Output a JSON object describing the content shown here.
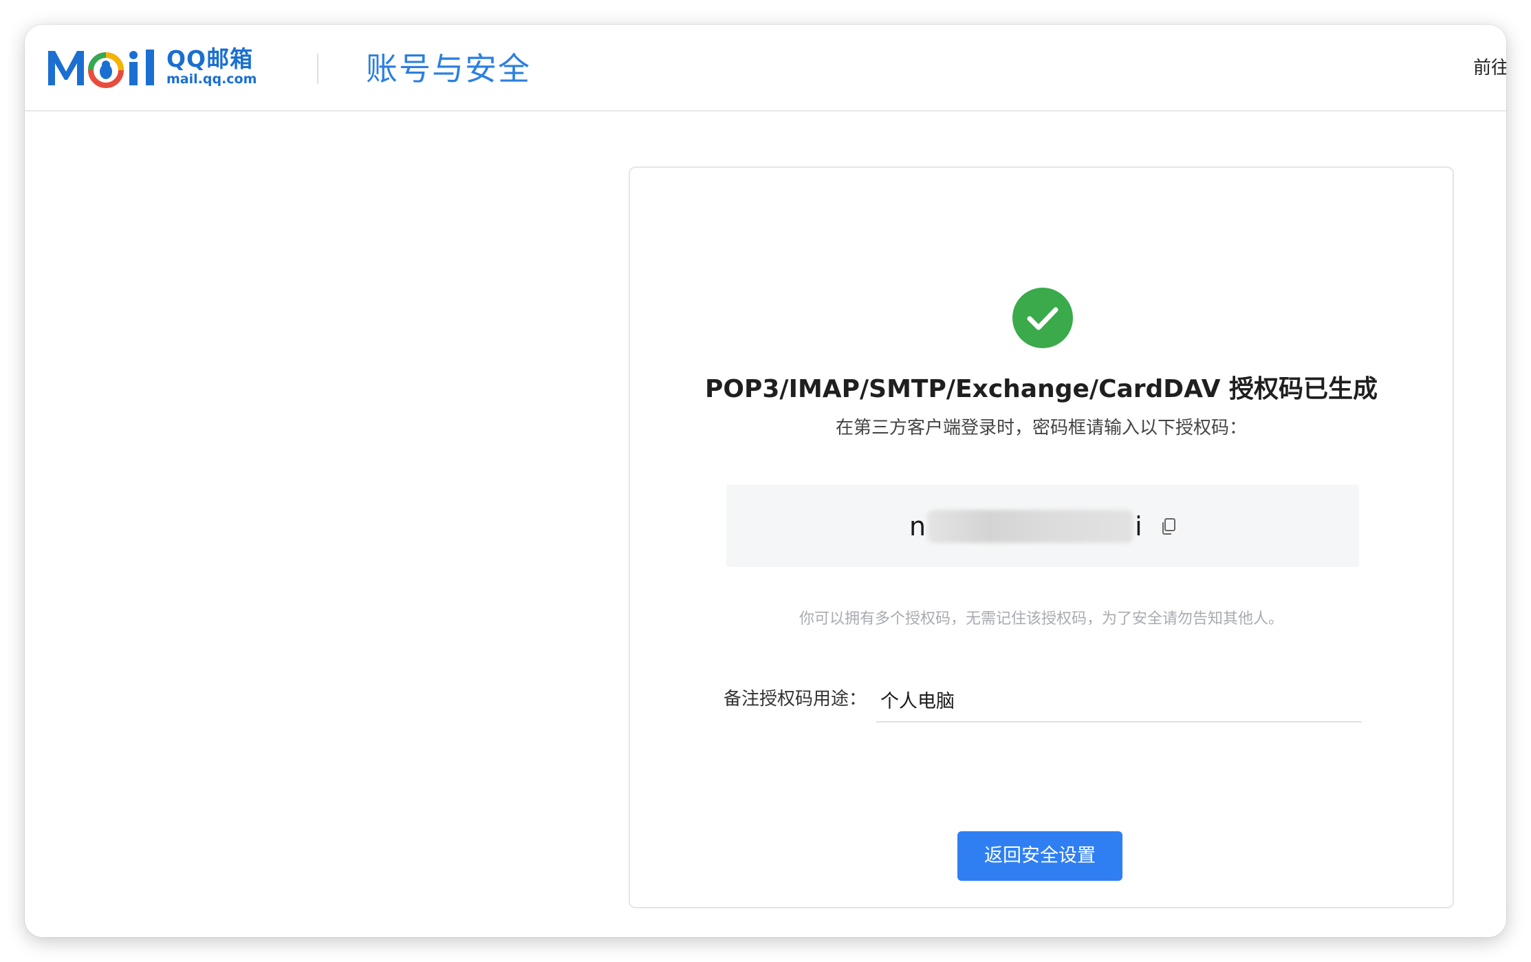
{
  "header": {
    "logo_cn": "QQ邮箱",
    "logo_en": "mail.qq.com",
    "title": "账号与安全",
    "right_link": "前往"
  },
  "card": {
    "title": "POP3/IMAP/SMTP/Exchange/CardDAV 授权码已生成",
    "subtitle": "在第三方客户端登录时，密码框请输入以下授权码：",
    "code_visible_start": "n",
    "code_visible_end": "i",
    "hint": "你可以拥有多个授权码，无需记住该授权码，为了安全请勿告知其他人。",
    "note_label": "备注授权码用途：",
    "note_value": "个人电脑",
    "back_button": "返回安全设置"
  },
  "icons": {
    "success": "check-circle-icon",
    "copy": "copy-icon"
  },
  "colors": {
    "accent": "#2f7ff3",
    "success": "#3aaa4a",
    "logo_blue": "#1a6fd0"
  }
}
